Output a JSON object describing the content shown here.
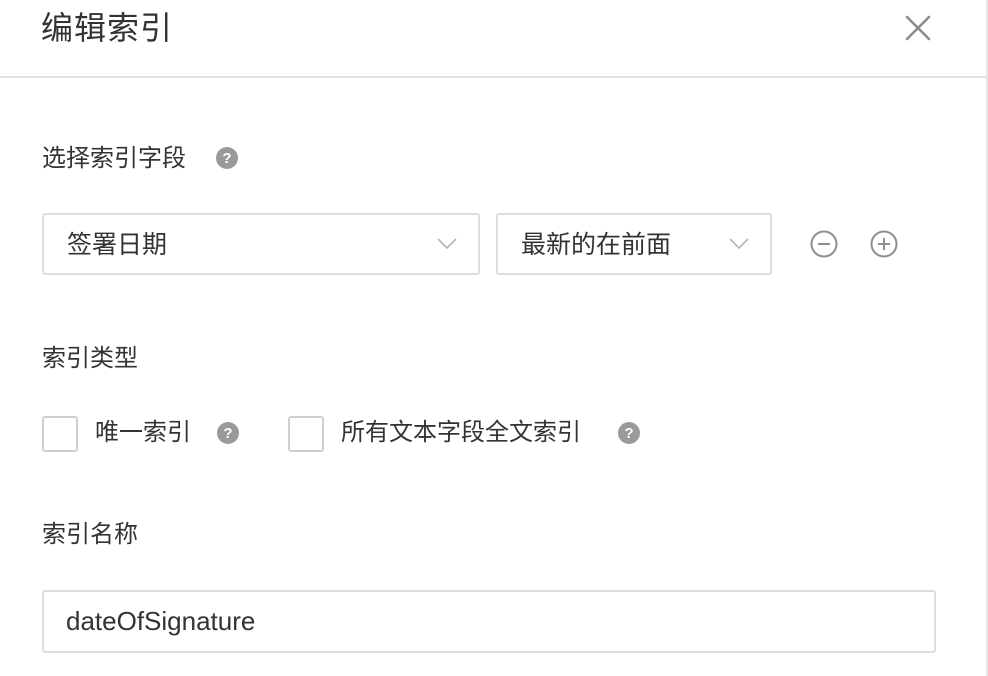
{
  "dialog": {
    "title": "编辑索引"
  },
  "field_section": {
    "label": "选择索引字段",
    "field_select": {
      "value": "签署日期"
    },
    "order_select": {
      "value": "最新的在前面"
    }
  },
  "type_section": {
    "label": "索引类型",
    "unique": {
      "label": "唯一索引",
      "checked": false
    },
    "fulltext": {
      "label": "所有文本字段全文索引",
      "checked": false
    }
  },
  "name_section": {
    "label": "索引名称",
    "input_value": "dateOfSignature"
  },
  "icons": {
    "close": "close-icon",
    "help": "help-icon",
    "chevron": "chevron-down-icon",
    "remove": "minus-circle-icon",
    "add": "plus-circle-icon"
  },
  "colors": {
    "text": "#333333",
    "border": "#dddddd",
    "icon_gray": "#999999",
    "help_gray": "#999999"
  }
}
